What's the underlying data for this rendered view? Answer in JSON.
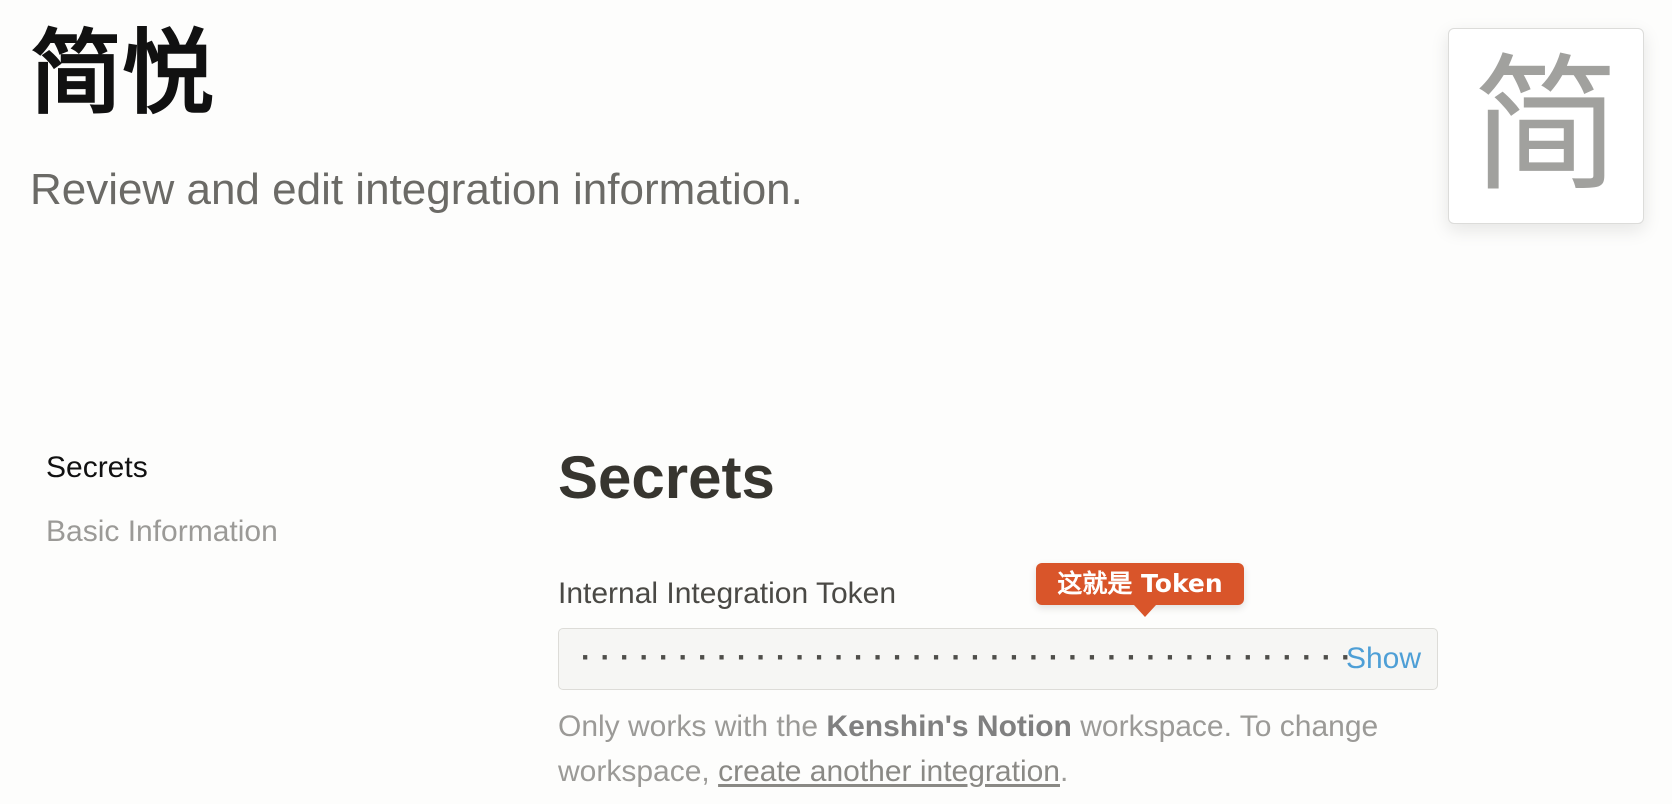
{
  "header": {
    "title": "简悦",
    "subtitle": "Review and edit integration information.",
    "icon_text": "简"
  },
  "sidebar": {
    "items": [
      {
        "label": "Secrets",
        "active": true
      },
      {
        "label": "Basic Information",
        "active": false
      }
    ]
  },
  "main": {
    "section_title": "Secrets",
    "token_field": {
      "label": "Internal Integration Token",
      "masked_value": "········································",
      "show_label": "Show"
    },
    "callout": {
      "text": "这就是 Token",
      "color": "#d9552a"
    },
    "help": {
      "prefix": "Only works with the ",
      "workspace_name": "Kenshin's Notion",
      "middle": " workspace. To change workspace, ",
      "link_text": "create another integration",
      "suffix": "."
    }
  },
  "colors": {
    "show_link": "#4e9fd6",
    "heading": "#37352f",
    "muted": "#9b9a97"
  }
}
